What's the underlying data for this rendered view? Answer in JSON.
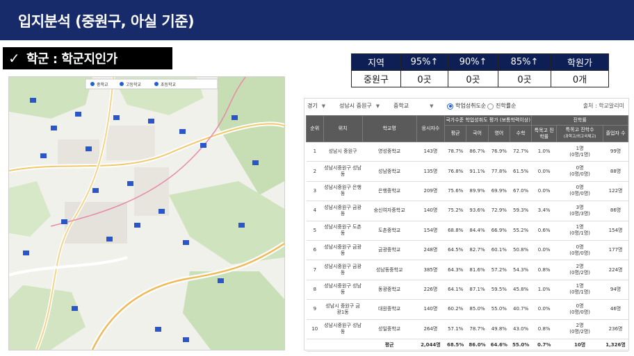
{
  "header": {
    "title": "입지분석 (중원구, 아실 기준)"
  },
  "section": {
    "label": "학군 : 학군지인가"
  },
  "summary": {
    "headers": [
      "지역",
      "95%↑",
      "90%↑",
      "85%↑",
      "학원가"
    ],
    "values": [
      "중원구",
      "0곳",
      "0곳",
      "0곳",
      "0개"
    ]
  },
  "map": {
    "legend": [
      "중학교",
      "고등학교",
      "초등학교"
    ]
  },
  "filters": {
    "province": "경기",
    "district": "성남시 중원구",
    "level": "중학교",
    "sort_options": [
      "학업성취도순",
      "진학률순"
    ],
    "source": "출처 : 학교알리미"
  },
  "table": {
    "h_rank": "순위",
    "h_location": "위치",
    "h_school": "학교명",
    "h_students": "응시자수",
    "h_group_score": "국가수준 학업성취도 평가 (보통학력이상)",
    "h_group_adv": "진학률",
    "h_avg": "평균",
    "h_kor": "국어",
    "h_eng": "영어",
    "h_math": "수학",
    "h_special": "특목고 진학률",
    "h_special_cnt": "특목고 진학수",
    "h_special_cnt_sub": "(과학고/외고국제고)",
    "h_grads": "졸업자 수",
    "rows": [
      {
        "rank": "1",
        "loc": "성남시 중원구",
        "school": "영성중학교",
        "students": "143명",
        "avg": "78.7%",
        "kor": "86.7%",
        "eng": "76.9%",
        "math": "72.7%",
        "sr": "1.0%",
        "sc": "1명",
        "scd": "(0명/1명)",
        "grads": "99명"
      },
      {
        "rank": "2",
        "loc": "성남시중원구 성남동",
        "school": "성남중학교",
        "students": "135명",
        "avg": "76.8%",
        "kor": "91.1%",
        "eng": "77.8%",
        "math": "61.5%",
        "sr": "0.0%",
        "sc": "0명",
        "scd": "(0명/0명)",
        "grads": "88명"
      },
      {
        "rank": "3",
        "loc": "성남시중원구 은행동",
        "school": "은행중학교",
        "students": "209명",
        "avg": "75.6%",
        "kor": "89.9%",
        "eng": "69.9%",
        "math": "67.0%",
        "sr": "0.0%",
        "sc": "0명",
        "scd": "(0명/0명)",
        "grads": "122명"
      },
      {
        "rank": "4",
        "loc": "성남시중원구 금광동",
        "school": "숭신여자중학교",
        "students": "140명",
        "avg": "75.2%",
        "kor": "93.6%",
        "eng": "72.9%",
        "math": "59.3%",
        "sr": "3.4%",
        "sc": "3명",
        "scd": "(0명/3명)",
        "grads": "86명"
      },
      {
        "rank": "5",
        "loc": "성남시중원구 도촌동",
        "school": "도촌중학교",
        "students": "154명",
        "avg": "68.8%",
        "kor": "84.4%",
        "eng": "66.9%",
        "math": "55.2%",
        "sr": "0.6%",
        "sc": "1명",
        "scd": "(0명/1명)",
        "grads": "154명"
      },
      {
        "rank": "6",
        "loc": "성남시중원구 금광동",
        "school": "금광중학교",
        "students": "248명",
        "avg": "64.5%",
        "kor": "82.7%",
        "eng": "60.1%",
        "math": "50.8%",
        "sr": "0.0%",
        "sc": "0명",
        "scd": "(0명/0명)",
        "grads": "177명"
      },
      {
        "rank": "7",
        "loc": "성남시중원구 금광동",
        "school": "성남동중학교",
        "students": "385명",
        "avg": "64.3%",
        "kor": "81.6%",
        "eng": "57.2%",
        "math": "54.3%",
        "sr": "0.8%",
        "sc": "2명",
        "scd": "(0명/2명)",
        "grads": "224명"
      },
      {
        "rank": "8",
        "loc": "성남시중원구 성남동",
        "school": "동광중학교",
        "students": "226명",
        "avg": "64.1%",
        "kor": "87.1%",
        "eng": "59.5%",
        "math": "45.8%",
        "sr": "1.0%",
        "sc": "1명",
        "scd": "(0명/1명)",
        "grads": "94명"
      },
      {
        "rank": "9",
        "loc": "성남시 중원구 금광1동",
        "school": "대원중학교",
        "students": "140명",
        "avg": "60.2%",
        "kor": "85.0%",
        "eng": "55.0%",
        "math": "40.7%",
        "sr": "0.0%",
        "sc": "0명",
        "scd": "(0명/0명)",
        "grads": "46명"
      },
      {
        "rank": "10",
        "loc": "성남시중원구 성남동",
        "school": "성일중학교",
        "students": "264명",
        "avg": "57.1%",
        "kor": "78.7%",
        "eng": "49.8%",
        "math": "43.0%",
        "sr": "0.8%",
        "sc": "2명",
        "scd": "(0명/2명)",
        "grads": "236명"
      }
    ],
    "footer": {
      "label": "평균",
      "students": "2,044명",
      "avg": "68.5%",
      "kor": "86.0%",
      "eng": "64.6%",
      "math": "55.0%",
      "sr": "0.7%",
      "sc": "10명",
      "grads": "1,326명"
    }
  },
  "colors": {
    "header_bg": "#172a6a",
    "summary_head": "#0e1f55",
    "table_head": "#5a5a5a",
    "radio_on": "#1f5fd6"
  }
}
